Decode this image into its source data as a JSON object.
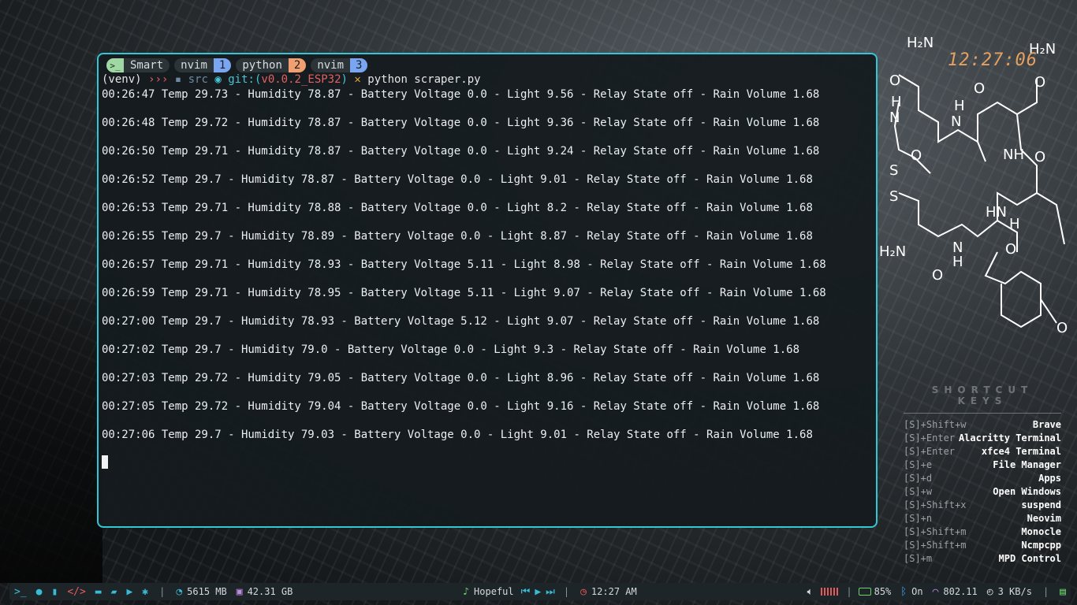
{
  "terminal": {
    "tabs": [
      {
        "label": "Smart",
        "num": ""
      },
      {
        "label": "nvim",
        "num": "1"
      },
      {
        "label": "python",
        "num": "2"
      },
      {
        "label": "nvim",
        "num": "3"
      }
    ],
    "prompt": {
      "venv": "(venv)",
      "arrows": "›››",
      "dir": "src",
      "git_label": "git:(",
      "branch": "v0.0.2_ESP32",
      "git_close": ")",
      "x": "✕",
      "command": "python scraper.py"
    },
    "output_lines": [
      "00:26:47 Temp 29.73 - Humidity 78.87 - Battery Voltage 0.0 - Light 9.56 - Relay State off - Rain Volume 1.68",
      "00:26:48 Temp 29.72 - Humidity 78.87 - Battery Voltage 0.0 - Light 9.36 - Relay State off - Rain Volume 1.68",
      "00:26:50 Temp 29.71 - Humidity 78.87 - Battery Voltage 0.0 - Light 9.24 - Relay State off - Rain Volume 1.68",
      "00:26:52 Temp 29.7 - Humidity 78.87 - Battery Voltage 0.0 - Light 9.01 - Relay State off - Rain Volume 1.68",
      "00:26:53 Temp 29.71 - Humidity 78.88 - Battery Voltage 0.0 - Light 8.2 - Relay State off - Rain Volume 1.68",
      "00:26:55 Temp 29.7 - Humidity 78.89 - Battery Voltage 0.0 - Light 8.87 - Relay State off - Rain Volume 1.68",
      "00:26:57 Temp 29.71 - Humidity 78.93 - Battery Voltage 5.11 - Light 8.98 - Relay State off - Rain Volume 1.68",
      "00:26:59 Temp 29.71 - Humidity 78.95 - Battery Voltage 5.11 - Light 9.07 - Relay State off - Rain Volume 1.68",
      "00:27:00 Temp 29.7 - Humidity 78.93 - Battery Voltage 5.12 - Light 9.07 - Relay State off - Rain Volume 1.68",
      "00:27:02 Temp 29.7 - Humidity 79.0 - Battery Voltage 0.0 - Light 9.3 - Relay State off - Rain Volume 1.68",
      "00:27:03 Temp 29.72 - Humidity 79.05 - Battery Voltage 0.0 - Light 8.96 - Relay State off - Rain Volume 1.68",
      "00:27:05 Temp 29.72 - Humidity 79.04 - Battery Voltage 0.0 - Light 9.16 - Relay State off - Rain Volume 1.68",
      "00:27:06 Temp 29.7 - Humidity 79.03 - Battery Voltage 0.0 - Light 9.01 - Relay State off - Rain Volume 1.68"
    ]
  },
  "desktop": {
    "clock": "12:27:06",
    "molecule_labels": [
      "H₂N",
      "O",
      "H",
      "N",
      "NH",
      "S",
      "HN",
      "O",
      "H₂N"
    ],
    "shortcuts_title": "SHORTCUT KEYS",
    "shortcuts": [
      {
        "key": "[S]+Shift+w",
        "action": "Brave"
      },
      {
        "key": "[S]+Enter",
        "action": "Alacritty Terminal"
      },
      {
        "key": "[S]+Enter",
        "action": "xfce4 Terminal"
      },
      {
        "key": "[S]+e",
        "action": "File Manager"
      },
      {
        "key": "[S]+d",
        "action": "Apps"
      },
      {
        "key": "[S]+w",
        "action": "Open Windows"
      },
      {
        "key": "[S]+Shift+x",
        "action": "suspend"
      },
      {
        "key": "[S]+n",
        "action": "Neovim"
      },
      {
        "key": "[S]+Shift+m",
        "action": "Monocle"
      },
      {
        "key": "[S]+Shift+m",
        "action": "Ncmpcpp"
      },
      {
        "key": "[S]+m",
        "action": "MPD Control"
      }
    ]
  },
  "statusbar": {
    "launchers": [
      "terminal-icon",
      "firefox-icon",
      "notes-icon",
      "code-icon",
      "chat-icon",
      "folder-icon",
      "youtube-icon",
      "settings-icon"
    ],
    "memory": "5615 MB",
    "disk": "42.31 GB",
    "music_title": "Hopeful",
    "time": "12:27 AM",
    "battery": "85%",
    "bluetooth": "On",
    "wifi": "802.11",
    "net_speed": "3 KB/s",
    "accent": "#38bcd6"
  }
}
